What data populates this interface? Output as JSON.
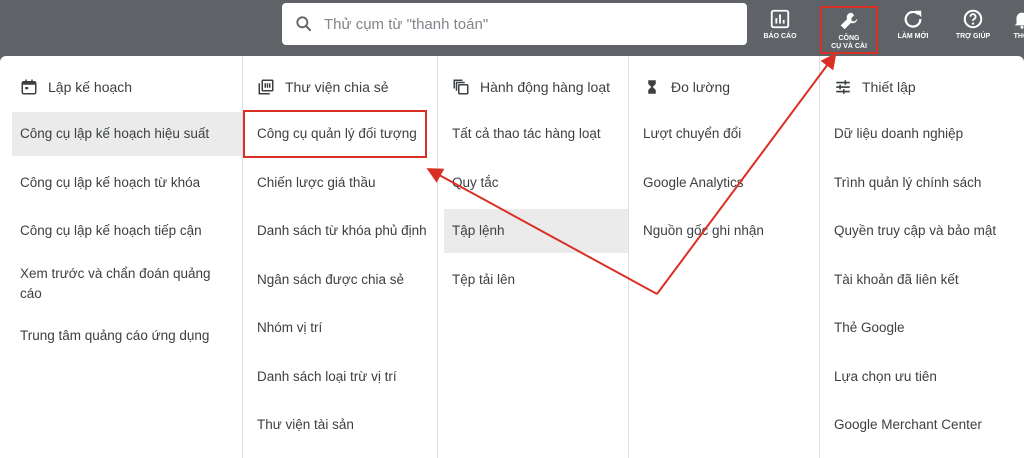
{
  "search": {
    "placeholder": "Thử cụm từ \"thanh toán\""
  },
  "toolbar": {
    "reports_label": "BÁO CÁO",
    "tools_label_1": "CÔNG",
    "tools_label_2": "CỤ VÀ CÀI",
    "refresh_label": "LÀM MỚI",
    "help_label": "TRỢ GIÚP",
    "more_label": "THÔI"
  },
  "columns": [
    {
      "title": "Lập kế hoạch",
      "items": [
        "Công cụ lập kế hoạch hiệu suất",
        "Công cụ lập kế hoạch từ khóa",
        "Công cụ lập kế hoạch tiếp cận",
        "Xem trước và chẩn đoán quảng cáo",
        "Trung tâm quảng cáo ứng dụng"
      ]
    },
    {
      "title": "Thư viện chia sẻ",
      "items": [
        "Công cụ quản lý đối tượng",
        "Chiến lược giá thầu",
        "Danh sách từ khóa phủ định",
        "Ngân sách được chia sẻ",
        "Nhóm vị trí",
        "Danh sách loại trừ vị trí",
        "Thư viện tài sản"
      ]
    },
    {
      "title": "Hành động hàng loạt",
      "items": [
        "Tất cả thao tác hàng loạt",
        "Quy tắc",
        "Tập lệnh",
        "Tệp tải lên"
      ]
    },
    {
      "title": "Đo lường",
      "items": [
        "Lượt chuyển đổi",
        "Google Analytics",
        "Nguồn gốc ghi nhận"
      ]
    },
    {
      "title": "Thiết lập",
      "items": [
        "Dữ liệu doanh nghiệp",
        "Trình quản lý chính sách",
        "Quyền truy cập và bảo mật",
        "Tài khoản đã liên kết",
        "Thẻ Google",
        "Lựa chọn ưu tiên",
        "Google Merchant Center"
      ]
    }
  ],
  "colors": {
    "annotation_red": "#d93025",
    "topbar": "#5f6368",
    "active_bg": "#ebebeb"
  }
}
